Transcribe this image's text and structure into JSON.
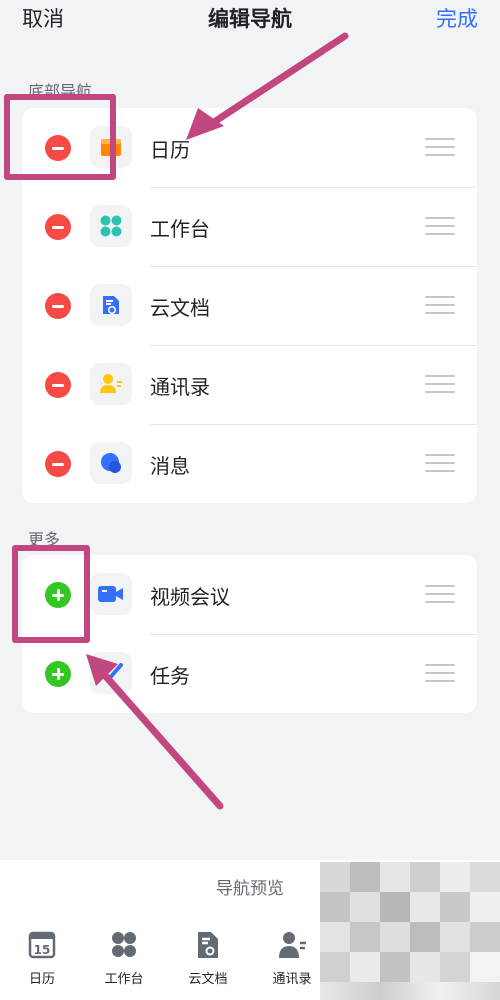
{
  "header": {
    "cancel": "取消",
    "title": "编辑导航",
    "done": "完成"
  },
  "sections": {
    "bottom_nav_label": "底部导航",
    "more_label": "更多"
  },
  "bottom_nav_items": [
    {
      "label": "日历",
      "icon": "calendar-icon",
      "action": "remove"
    },
    {
      "label": "工作台",
      "icon": "workspace-icon",
      "action": "remove"
    },
    {
      "label": "云文档",
      "icon": "cloud-doc-icon",
      "action": "remove"
    },
    {
      "label": "通讯录",
      "icon": "contacts-icon",
      "action": "remove"
    },
    {
      "label": "消息",
      "icon": "message-icon",
      "action": "remove"
    }
  ],
  "more_items": [
    {
      "label": "视频会议",
      "icon": "video-meeting-icon",
      "action": "add"
    },
    {
      "label": "任务",
      "icon": "task-icon",
      "action": "add"
    }
  ],
  "preview": {
    "title": "导航预览",
    "tabs": [
      {
        "label": "日历",
        "icon": "calendar-icon",
        "date_text": "15"
      },
      {
        "label": "工作台",
        "icon": "workspace-icon"
      },
      {
        "label": "云文档",
        "icon": "cloud-doc-icon"
      },
      {
        "label": "通讯录",
        "icon": "contacts-icon"
      }
    ]
  },
  "colors": {
    "remove": "#f54a45",
    "add": "#34c724",
    "accent": "#3370ff",
    "annotation": "#c2467f"
  }
}
